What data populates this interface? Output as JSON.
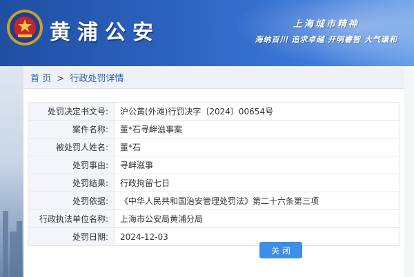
{
  "header": {
    "site_title": "黄浦公安",
    "slogan_line1": "上海城市精神",
    "slogan_line2": "海纳百川 追求卓越 开明睿智 大气谦和"
  },
  "breadcrumb": {
    "home": "首 页",
    "separator": ">",
    "current": "行政处罚详情"
  },
  "details": [
    {
      "label": "处罚决定书文号:",
      "value": "沪公黄(外滩)行罚决字〔2024〕00654号"
    },
    {
      "label": "案件名称:",
      "value": "董*石寻衅滋事案"
    },
    {
      "label": "被处罚人姓名:",
      "value": "董*石"
    },
    {
      "label": "处罚事由:",
      "value": "寻衅滋事"
    },
    {
      "label": "处罚结果:",
      "value": "行政拘留七日"
    },
    {
      "label": "处罚依据:",
      "value": "《中华人民共和国治安管理处罚法》第二十六条第三项"
    },
    {
      "label": "行政执法单位名称:",
      "value": "上海市公安局黄浦分局"
    },
    {
      "label": "处罚日期:",
      "value": "2024-12-03"
    }
  ],
  "actions": {
    "close_label": "关 闭"
  },
  "colors": {
    "header_blue": "#2c62bf",
    "link_blue": "#2a5db0",
    "button_blue": "#3d8ee8"
  },
  "icons": {
    "emblem": "police-emblem-icon"
  }
}
